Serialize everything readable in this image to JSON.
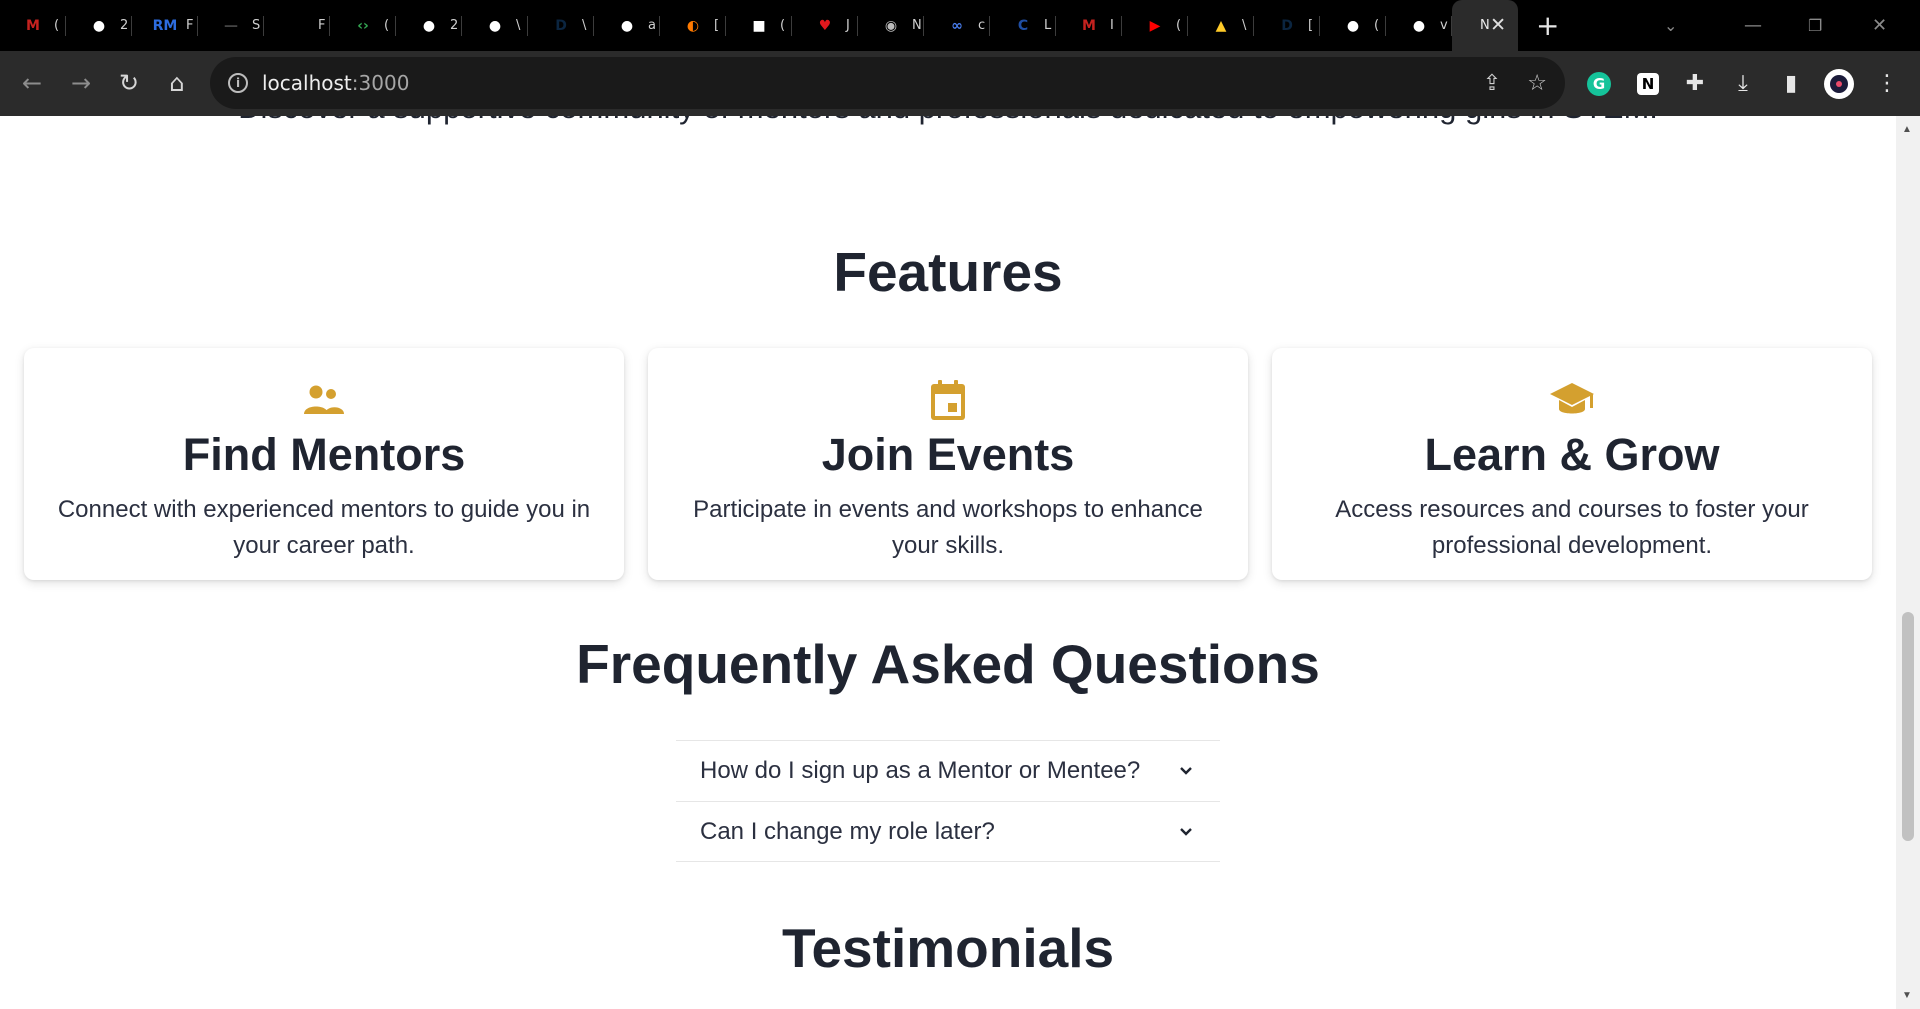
{
  "browser": {
    "tabs": [
      {
        "icon": "gmail-icon",
        "glyph": "M",
        "color": "#c5221f",
        "text": "("
      },
      {
        "icon": "github-icon",
        "glyph": "●",
        "color": "#ffffff",
        "text": "2"
      },
      {
        "icon": "rm-icon",
        "glyph": "RM",
        "color": "#2d6cdf",
        "text": "F"
      },
      {
        "icon": "blank-icon",
        "glyph": "—",
        "color": "#444444",
        "text": "S"
      },
      {
        "icon": "blank-icon",
        "glyph": "",
        "color": "#000000",
        "text": "F"
      },
      {
        "icon": "code-icon",
        "glyph": "‹›",
        "color": "#34a853",
        "text": "("
      },
      {
        "icon": "github-icon",
        "glyph": "●",
        "color": "#ffffff",
        "text": "2"
      },
      {
        "icon": "github-icon",
        "glyph": "●",
        "color": "#ffffff",
        "text": "\\"
      },
      {
        "icon": "dev-icon",
        "glyph": "D",
        "color": "#0b2540",
        "text": "\\"
      },
      {
        "icon": "github-icon",
        "glyph": "●",
        "color": "#ffffff",
        "text": "a"
      },
      {
        "icon": "firefox-icon",
        "glyph": "◐",
        "color": "#ff7a00",
        "text": "["
      },
      {
        "icon": "white-square-icon",
        "glyph": "■",
        "color": "#ffffff",
        "text": "("
      },
      {
        "icon": "heart-icon",
        "glyph": "♥",
        "color": "#e0181d",
        "text": "J"
      },
      {
        "icon": "globe-icon",
        "glyph": "◉",
        "color": "#bbbbbb",
        "text": "N"
      },
      {
        "icon": "link-icon",
        "glyph": "∞",
        "color": "#4a7ff0",
        "text": "c"
      },
      {
        "icon": "calendar-icon",
        "glyph": "C",
        "color": "#1f4ea3",
        "text": "L"
      },
      {
        "icon": "gmail-icon",
        "glyph": "M",
        "color": "#c5221f",
        "text": "I"
      },
      {
        "icon": "youtube-icon",
        "glyph": "▶",
        "color": "#ff0000",
        "text": "("
      },
      {
        "icon": "firebase-icon",
        "glyph": "▲",
        "color": "#ffca28",
        "text": "\\"
      },
      {
        "icon": "dev-icon",
        "glyph": "D",
        "color": "#0b2540",
        "text": "["
      },
      {
        "icon": "github-icon",
        "glyph": "●",
        "color": "#ffffff",
        "text": "("
      },
      {
        "icon": "github-icon",
        "glyph": "●",
        "color": "#ffffff",
        "text": "v"
      }
    ],
    "active_tab_text": "N",
    "url_host": "localhost",
    "url_port": ":3000"
  },
  "page": {
    "intro": "Discover a supportive community of mentors and professionals dedicated to empowering girls in STEM.",
    "features_title": "Features",
    "features": [
      {
        "icon": "people-icon",
        "title": "Find Mentors",
        "desc": "Connect with experienced mentors to guide you in your career path."
      },
      {
        "icon": "calendar-event-icon",
        "title": "Join Events",
        "desc": "Participate in events and workshops to enhance your skills."
      },
      {
        "icon": "graduation-cap-icon",
        "title": "Learn & Grow",
        "desc": "Access resources and courses to foster your professional development."
      }
    ],
    "faq_title": "Frequently Asked Questions",
    "faqs": [
      {
        "question": "How do I sign up as a Mentor or Mentee?"
      },
      {
        "question": "Can I change my role later?"
      }
    ],
    "testimonials_title": "Testimonials"
  },
  "colors": {
    "accent": "#d4a02f",
    "text": "#1f2430"
  }
}
